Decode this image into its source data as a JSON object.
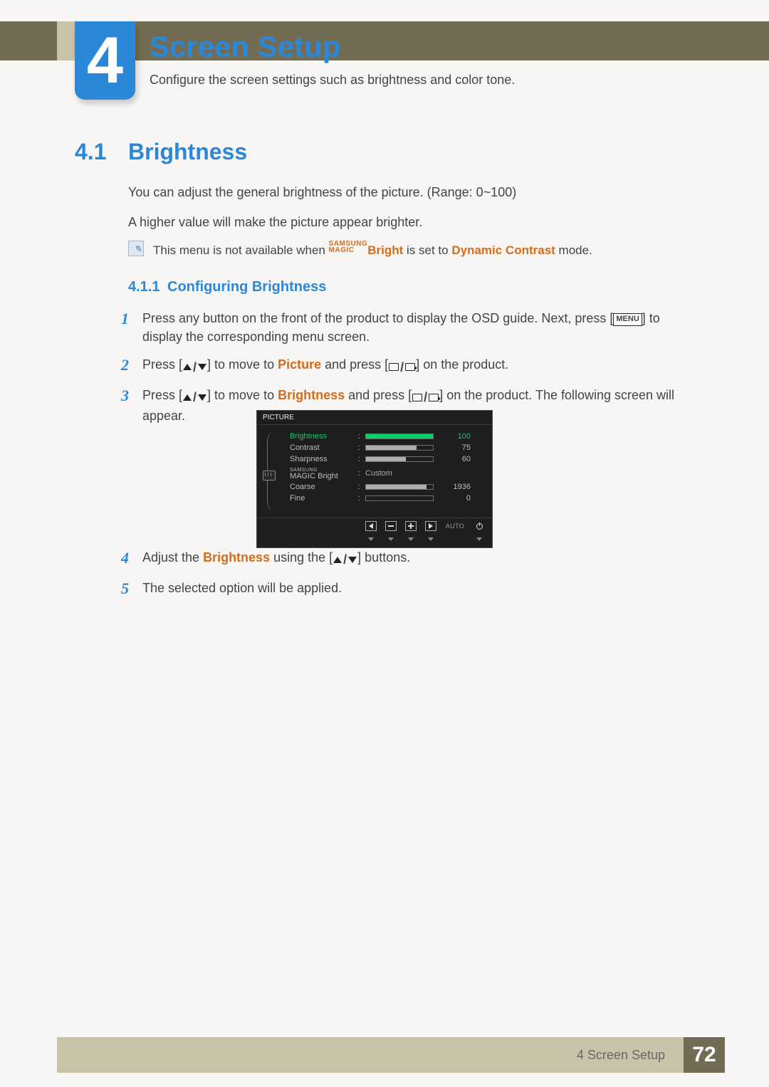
{
  "chapter": {
    "number": "4",
    "title": "Screen Setup",
    "subtitle": "Configure the screen settings such as brightness and color tone."
  },
  "section": {
    "number": "4.1",
    "title": "Brightness"
  },
  "para1": "You can adjust the general brightness of the picture. (Range: 0~100)",
  "para2": "A higher value will make the picture appear brighter.",
  "note": {
    "pre": "This menu is not available when ",
    "magic_top": "SAMSUNG",
    "magic_bot": "MAGIC",
    "bright": "Bright",
    "mid": " is set to ",
    "dc": "Dynamic Contrast",
    "post": " mode."
  },
  "subsection": {
    "number": "4.1.1",
    "title": "Configuring Brightness"
  },
  "steps": {
    "s1a": "Press any button on the front of the product to display the OSD guide. Next, press [",
    "s1menu": "MENU",
    "s1b": "] to display the corresponding menu screen.",
    "s2a": "Press [",
    "s2b": "] to move to ",
    "s2picture": "Picture",
    "s2c": " and press [",
    "s2d": "] on the product.",
    "s3a": "Press [",
    "s3b": "] to move to ",
    "s3bright": "Brightness",
    "s3c": " and press [",
    "s3d": "] on the product. The following screen will appear.",
    "s4a": "Adjust the ",
    "s4bright": "Brightness",
    "s4b": " using the [",
    "s4c": "] buttons.",
    "s5": "The selected option will be applied."
  },
  "osd": {
    "title": "PICTURE",
    "rows": {
      "brightness": {
        "label": "Brightness",
        "value": "100",
        "pct": 100
      },
      "contrast": {
        "label": "Contrast",
        "value": "75",
        "pct": 75
      },
      "sharpness": {
        "label": "Sharpness",
        "value": "60",
        "pct": 60
      },
      "magic": {
        "label_top": "SAMSUNG",
        "label_bot": "MAGIC Bright",
        "value": "Custom"
      },
      "coarse": {
        "label": "Coarse",
        "value": "1936",
        "pct": 90
      },
      "fine": {
        "label": "Fine",
        "value": "0",
        "pct": 0
      }
    },
    "auto": "AUTO"
  },
  "footer": {
    "chapter": "4 Screen Setup",
    "page": "72"
  },
  "chart_data": {
    "type": "bar",
    "title": "PICTURE OSD settings",
    "series": [
      {
        "name": "Brightness",
        "value": 100
      },
      {
        "name": "Contrast",
        "value": 75
      },
      {
        "name": "Sharpness",
        "value": 60
      },
      {
        "name": "Coarse",
        "value": 1936
      },
      {
        "name": "Fine",
        "value": 0
      }
    ]
  }
}
